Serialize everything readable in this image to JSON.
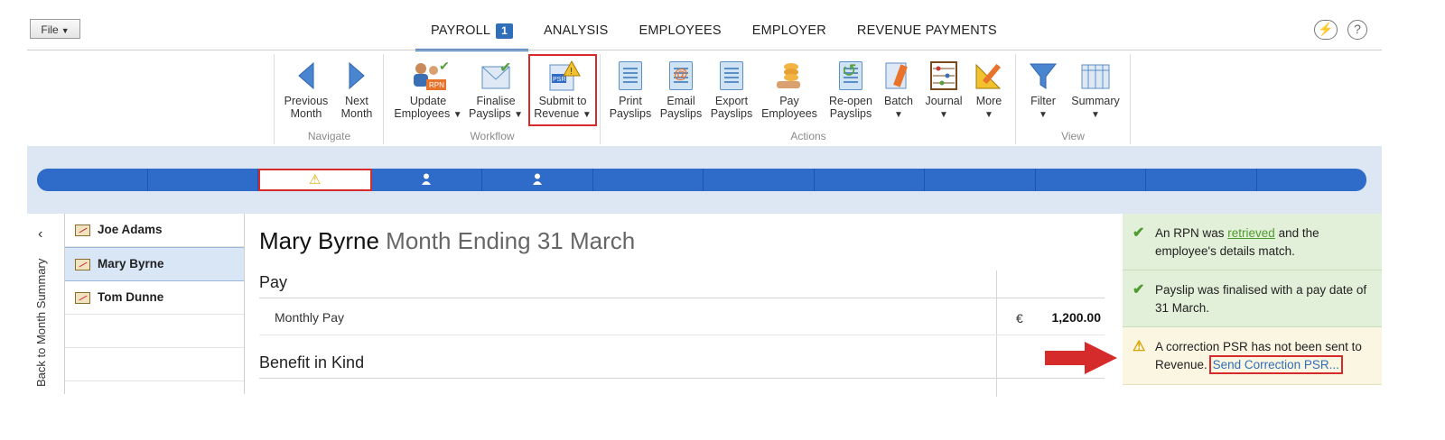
{
  "file_menu": {
    "label": "File"
  },
  "tabs": [
    {
      "label": "PAYROLL",
      "badge": "1"
    },
    {
      "label": "ANALYSIS"
    },
    {
      "label": "EMPLOYEES"
    },
    {
      "label": "EMPLOYER"
    },
    {
      "label": "REVENUE PAYMENTS"
    }
  ],
  "ribbon": {
    "navigate": {
      "label": "Navigate",
      "previous": "Previous Month",
      "next": "Next Month"
    },
    "workflow": {
      "label": "Workflow",
      "update": "Update Employees",
      "finalise": "Finalise Payslips",
      "submit": "Submit to Revenue",
      "rpn_tag": "RPN",
      "psr_tag": "PSR"
    },
    "actions": {
      "label": "Actions",
      "print": "Print Payslips",
      "email": "Email Payslips",
      "export": "Export Payslips",
      "pay": "Pay Employees",
      "reopen": "Re-open Payslips",
      "batch": "Batch",
      "journal": "Journal",
      "more": "More"
    },
    "view": {
      "label": "View",
      "filter": "Filter",
      "summary": "Summary"
    }
  },
  "back_link": "Back to Month Summary",
  "employees": [
    "Joe Adams",
    "Mary Byrne",
    "Tom Dunne"
  ],
  "main": {
    "employee_name": "Mary Byrne",
    "period": "Month Ending 31 March",
    "pay_section": "Pay",
    "monthly_pay_label": "Monthly Pay",
    "currency": "€",
    "monthly_pay_value": "1,200.00",
    "bik_section": "Benefit in Kind"
  },
  "notices": {
    "rpn_text_1": "An RPN was ",
    "rpn_link": "retrieved",
    "rpn_text_2": " and the employee's details match.",
    "payslip_text": "Payslip was finalised with a pay date of 31 March.",
    "psr_text": "A correction PSR has not been sent to Revenue.",
    "psr_link": "Send Correction PSR..."
  },
  "colors": {
    "accent": "#2f6bc8",
    "highlight": "#d62b2b",
    "ok_bg": "#e2efd9",
    "warn_bg": "#fbf6e2"
  }
}
